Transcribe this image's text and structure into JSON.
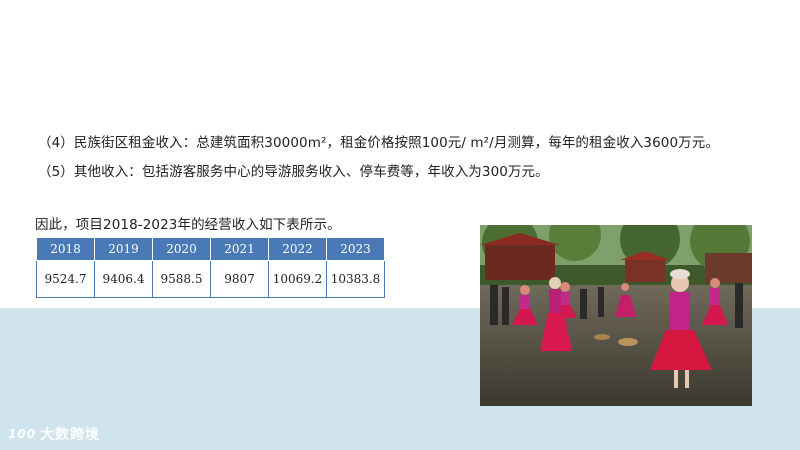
{
  "text": {
    "line1": "（4）民族街区租金收入：总建筑面积30000m²，租金价格按照100元/ m²/月测算，每年的租金收入3600万元。",
    "line2": "（5）其他收入：包括游客服务中心的导游服务收入、停车费等，年收入为300万元。",
    "intro": "因此，项目2018-2023年的经营收入如下表所示。"
  },
  "table": {
    "headers": [
      "2018",
      "2019",
      "2020",
      "2021",
      "2022",
      "2023"
    ],
    "values": [
      "9524.7",
      "9406.4",
      "9588.5",
      "9807",
      "10069.2",
      "10383.8"
    ]
  },
  "watermark": {
    "mark": "100",
    "text": "大数跨境"
  },
  "colors": {
    "table_header": "#4a79b8",
    "band": "#cfe4ec"
  }
}
